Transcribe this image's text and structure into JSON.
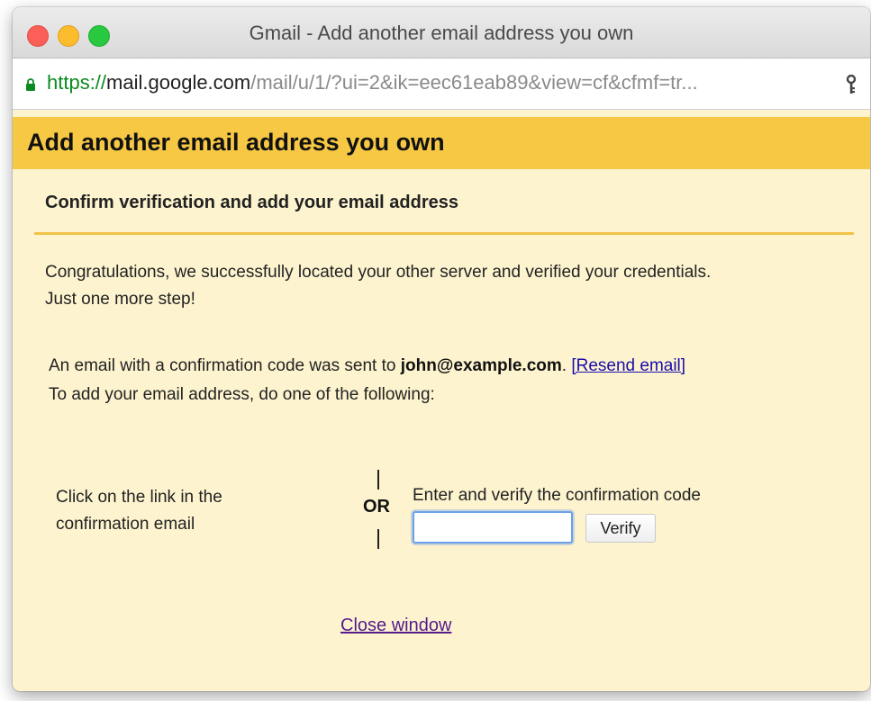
{
  "window": {
    "title": "Gmail - Add another email address you own"
  },
  "address_bar": {
    "url_scheme": "https://",
    "url_host": "mail.google.com",
    "url_path": "/mail/u/1/?ui=2&ik=eec61eab89&view=cf&cfmf=tr..."
  },
  "dialog": {
    "title": "Add another email address you own",
    "section_title": "Confirm verification and add your email address",
    "congrats_line1": "Congratulations, we successfully located your other server and verified your credentials.",
    "congrats_line2": "Just one more step!",
    "sent_prefix": "An email with a confirmation code was sent to ",
    "email": "john@example.com",
    "sent_suffix": ". ",
    "resend_label": "[Resend email]",
    "todo": "To add your email address, do one of the following:",
    "option_link_text": "Click on the link in the confirmation email",
    "or_label": "OR",
    "code_label": "Enter and verify the confirmation code",
    "code_value": "",
    "verify_label": "Verify",
    "close_label": "Close window"
  },
  "colors": {
    "header_band": "#f6c844",
    "panel_background": "#fdf4cf",
    "divider": "#f0c24a",
    "link": "#1a0dab",
    "visited_link": "#551a8b",
    "secure_scheme": "#0a8a1f"
  },
  "icons": [
    "close-window-dot",
    "minimize-window-dot",
    "maximize-window-dot",
    "lock-icon",
    "key-icon"
  ]
}
